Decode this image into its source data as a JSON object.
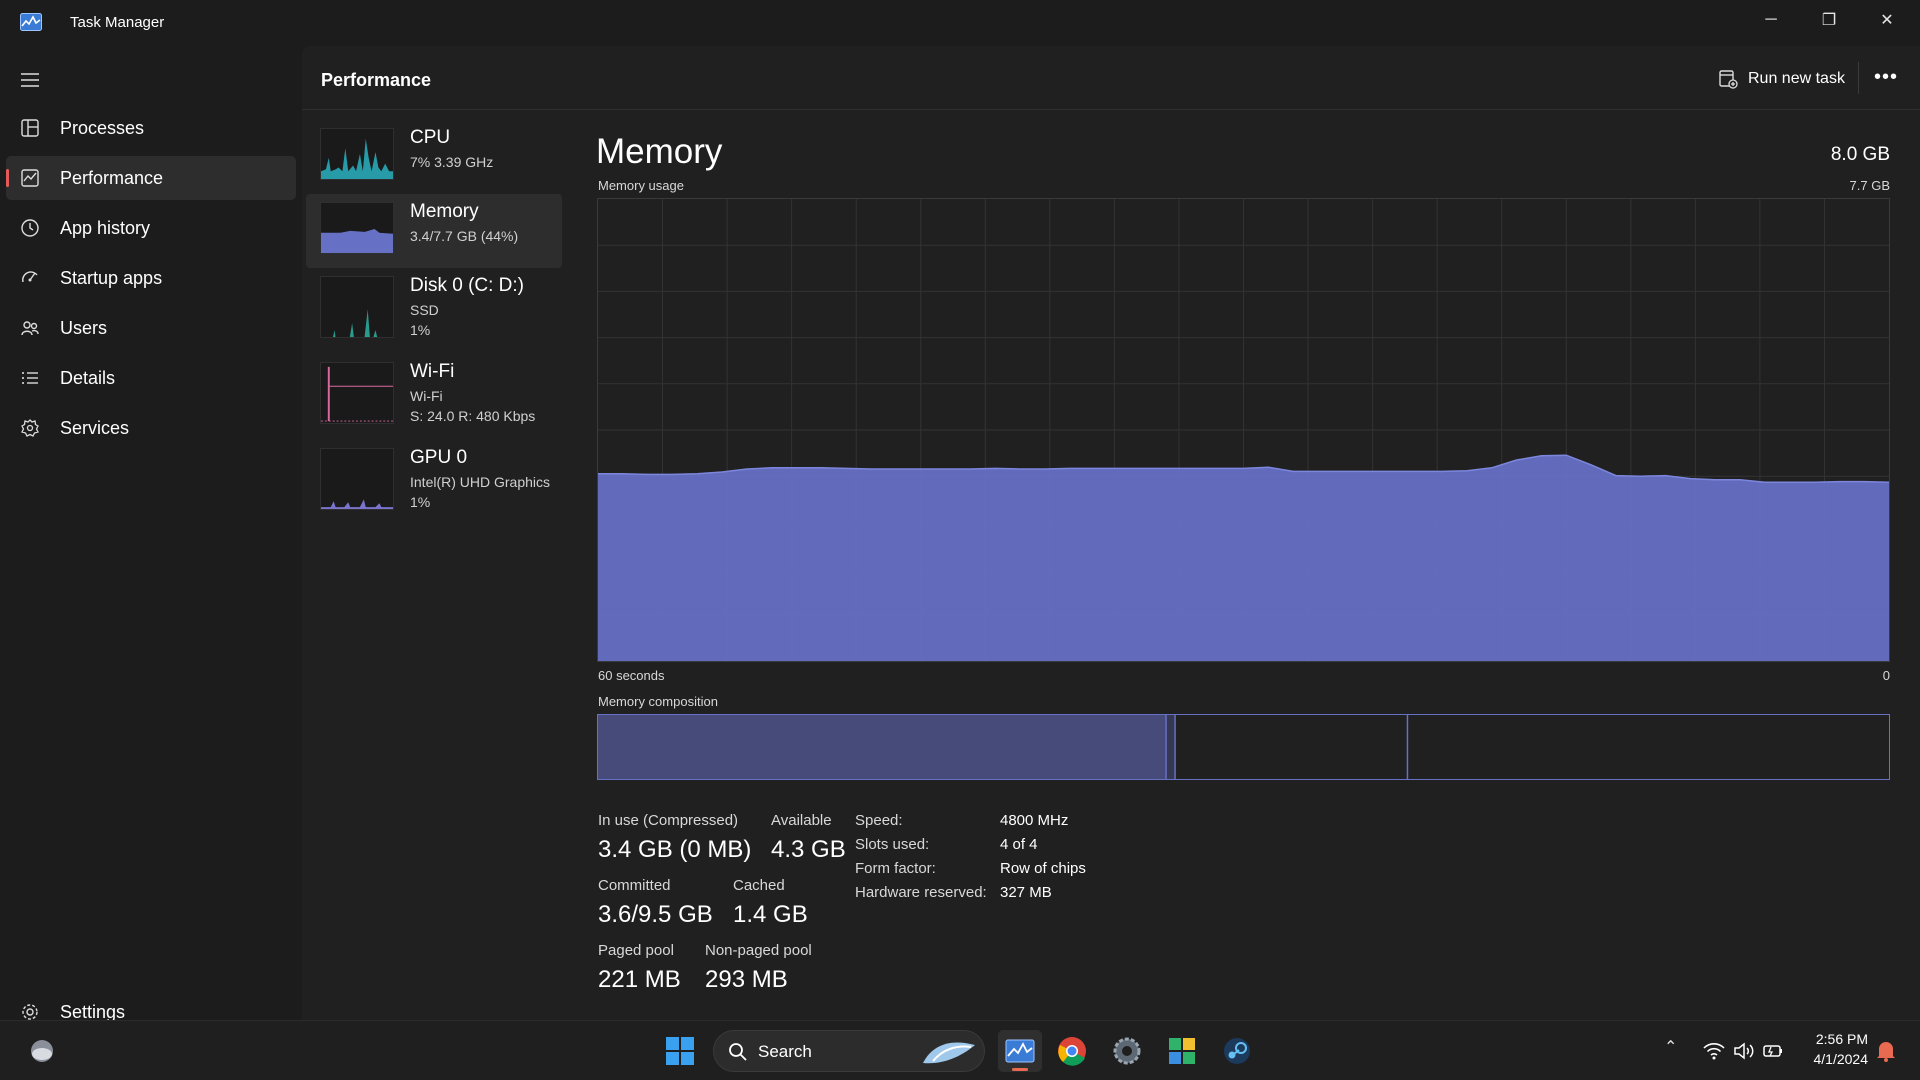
{
  "window": {
    "title": "Task Manager",
    "minimize_glyph": "─",
    "restore_glyph": "❐",
    "close_glyph": "✕"
  },
  "sidebar": {
    "items": [
      {
        "label": "Processes",
        "icon": "processes-icon"
      },
      {
        "label": "Performance",
        "icon": "performance-icon",
        "active": true
      },
      {
        "label": "App history",
        "icon": "app-history-icon"
      },
      {
        "label": "Startup apps",
        "icon": "startup-apps-icon"
      },
      {
        "label": "Users",
        "icon": "users-icon"
      },
      {
        "label": "Details",
        "icon": "details-icon"
      },
      {
        "label": "Services",
        "icon": "services-icon"
      }
    ],
    "settings_label": "Settings"
  },
  "header": {
    "title": "Performance",
    "run_new_task_label": "Run new task",
    "more_label": "•••"
  },
  "resources": [
    {
      "name": "CPU",
      "sub1": "7%  3.39 GHz",
      "sub2": "",
      "color": "#2ab3c2"
    },
    {
      "name": "Memory",
      "sub1": "3.4/7.7 GB (44%)",
      "sub2": "",
      "color": "#6670c4"
    },
    {
      "name": "Disk 0 (C: D:)",
      "sub1": "SSD",
      "sub2": "1%",
      "color": "#2a9a8c"
    },
    {
      "name": "Wi-Fi",
      "sub1": "Wi-Fi",
      "sub2": "S: 24.0  R: 480 Kbps",
      "color": "#d96aa0"
    },
    {
      "name": "GPU 0",
      "sub1": "Intel(R) UHD Graphics",
      "sub2": "1%",
      "color": "#7a74cf"
    }
  ],
  "detail": {
    "title": "Memory",
    "total": "8.0 GB",
    "usage_label": "Memory usage",
    "usage_max": "7.7 GB",
    "time_label": "60 seconds",
    "time_end": "0",
    "composition_label": "Memory composition",
    "composition": {
      "in_use_fraction": 0.44,
      "modified_fraction": 0.007,
      "standby_fraction": 0.18
    },
    "stats": {
      "in_use_label": "In use (Compressed)",
      "in_use_value": "3.4 GB (0 MB)",
      "available_label": "Available",
      "available_value": "4.3 GB",
      "committed_label": "Committed",
      "committed_value": "3.6/9.5 GB",
      "cached_label": "Cached",
      "cached_value": "1.4 GB",
      "paged_label": "Paged pool",
      "paged_value": "221 MB",
      "nonpaged_label": "Non-paged pool",
      "nonpaged_value": "293 MB"
    },
    "specs": [
      {
        "label": "Speed:",
        "value": "4800 MHz"
      },
      {
        "label": "Slots used:",
        "value": "4 of 4"
      },
      {
        "label": "Form factor:",
        "value": "Row of chips"
      },
      {
        "label": "Hardware reserved:",
        "value": "327 MB"
      }
    ],
    "usage_series_gb": [
      3.12,
      3.12,
      3.11,
      3.11,
      3.12,
      3.15,
      3.2,
      3.22,
      3.22,
      3.22,
      3.21,
      3.2,
      3.2,
      3.2,
      3.2,
      3.2,
      3.21,
      3.2,
      3.2,
      3.21,
      3.21,
      3.21,
      3.21,
      3.21,
      3.21,
      3.21,
      3.21,
      3.23,
      3.16,
      3.16,
      3.16,
      3.16,
      3.16,
      3.16,
      3.16,
      3.17,
      3.22,
      3.35,
      3.42,
      3.43,
      3.27,
      3.09,
      3.08,
      3.09,
      3.04,
      3.02,
      3.02,
      2.98,
      2.98,
      2.98,
      2.99,
      2.99,
      2.98
    ],
    "accent_color": "#6670c4"
  },
  "taskbar": {
    "search_label": "Search",
    "time": "2:56 PM",
    "date": "4/1/2024"
  }
}
